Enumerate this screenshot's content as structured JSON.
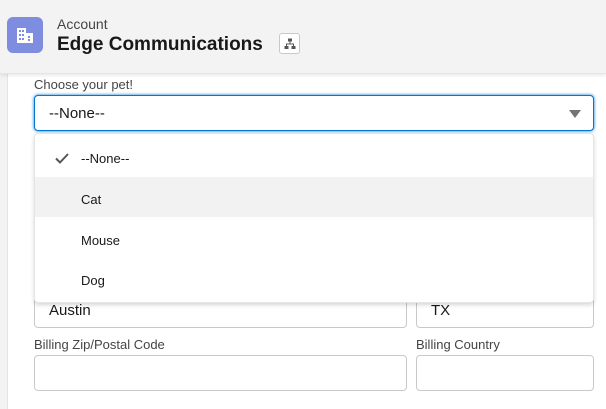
{
  "header": {
    "object_label": "Account",
    "record_title": "Edge Communications",
    "icons": {
      "object": "account-building-icon",
      "hierarchy": "hierarchy-icon"
    },
    "colors": {
      "object_icon_bg": "#7f8de1",
      "focus": "#0176d3"
    }
  },
  "pet_field": {
    "label": "Choose your pet!",
    "selected_value": "--None--",
    "options": [
      {
        "label": "--None--",
        "selected": true
      },
      {
        "label": "Cat",
        "hovered": true
      },
      {
        "label": "Mouse"
      },
      {
        "label": "Dog"
      }
    ]
  },
  "billing": {
    "city_value": "Austin",
    "state_value": "TX",
    "zip_label": "Billing Zip/Postal Code",
    "zip_value": "",
    "country_label": "Billing Country",
    "country_value": ""
  }
}
